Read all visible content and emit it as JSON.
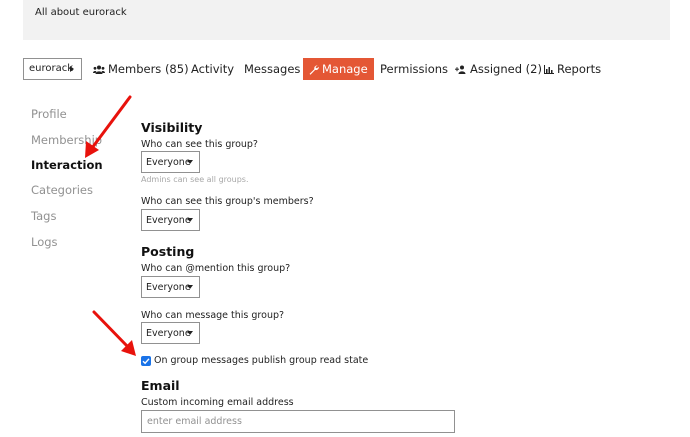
{
  "header": {
    "about_text": "All about eurorack"
  },
  "nav": {
    "group_selector": "eurorack",
    "items": [
      {
        "label": "Members (85)",
        "icon": "users-icon"
      },
      {
        "label": "Activity"
      },
      {
        "label": "Messages"
      },
      {
        "label": "Manage",
        "icon": "wrench-icon",
        "active": true
      },
      {
        "label": "Permissions"
      },
      {
        "label": "Assigned (2)",
        "icon": "user-plus-icon"
      },
      {
        "label": "Reports",
        "icon": "chart-icon"
      }
    ],
    "active_color": "#e45735"
  },
  "sidebar": {
    "items": [
      {
        "label": "Profile"
      },
      {
        "label": "Membership"
      },
      {
        "label": "Interaction",
        "current": true
      },
      {
        "label": "Categories"
      },
      {
        "label": "Tags"
      },
      {
        "label": "Logs"
      }
    ]
  },
  "visibility": {
    "title": "Visibility",
    "see_group_label": "Who can see this group?",
    "see_group_value": "Everyone",
    "see_group_hint": "Admins can see all groups.",
    "see_members_label": "Who can see this group's members?",
    "see_members_value": "Everyone"
  },
  "posting": {
    "title": "Posting",
    "mention_label": "Who can @mention this group?",
    "mention_value": "Everyone",
    "message_label": "Who can message this group?",
    "message_value": "Everyone",
    "read_state_label": "On group messages publish group read state",
    "read_state_checked": true
  },
  "email": {
    "title": "Email",
    "incoming_label": "Custom incoming email address",
    "incoming_placeholder": "enter email address"
  },
  "annotations": {
    "arrow_color": "#e8120c"
  }
}
